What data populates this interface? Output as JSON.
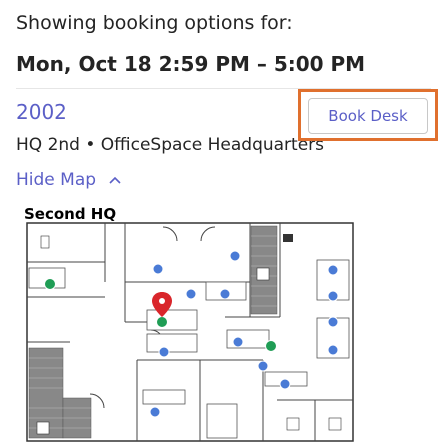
{
  "header": {
    "title": "Showing booking options for:",
    "datetime": "Mon, Oct 18 2:59 PM – 5:00 PM"
  },
  "desk": {
    "name": "2002",
    "location": "HQ 2nd • OfficeSpace Headquarters",
    "book_label": "Book Desk"
  },
  "map_toggle": {
    "label": "Hide Map",
    "icon": "chevron-up-icon"
  },
  "map": {
    "title": "Second HQ"
  },
  "colors": {
    "accent": "#5b5fc7",
    "highlight": "#e0702e",
    "pin": "#d9262b",
    "available": "#1f9d55",
    "booked": "#4a7bd6"
  }
}
